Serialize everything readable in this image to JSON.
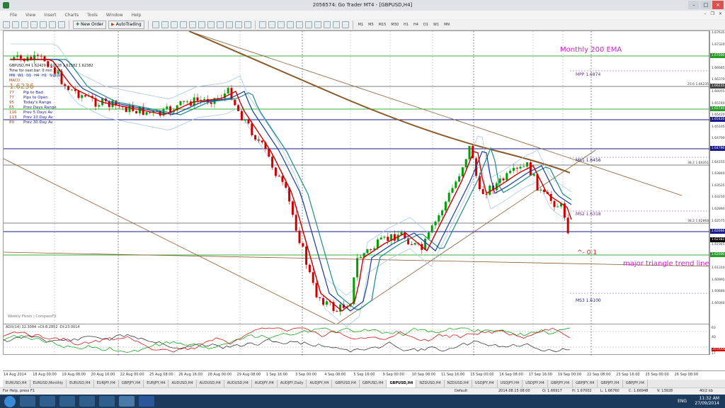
{
  "window": {
    "title": "2056574: Go Trader MT4 - [GBPUSD,H4]"
  },
  "menu": [
    "File",
    "View",
    "Insert",
    "Charts",
    "Tools",
    "Window",
    "Help"
  ],
  "toolbar": {
    "new_order": "New Order",
    "autotrading": "AutoTrading",
    "timeframes": [
      "M1",
      "M5",
      "M15",
      "M30",
      "H1",
      "H4",
      "D1",
      "W1",
      "MN"
    ]
  },
  "chart": {
    "header": "GBPUSD,H4  1.62429 1.62528 1.62382 1.62382",
    "time_line": "Time for next bar: 0 min 1 sec",
    "timeframe_row": [
      "MN",
      "W1",
      "D1",
      "H4",
      "H1",
      "Signals"
    ],
    "macd_label": "MACD",
    "price_big": "1.6236",
    "info_rows": [
      {
        "num": "77",
        "label": "Pip to Bad"
      },
      {
        "num": "77",
        "label": "Pips to Open"
      },
      {
        "num": "95",
        "label": "Today's Range"
      },
      {
        "num": "65",
        "label": "Prev Days Range"
      },
      {
        "num": "116",
        "label": "Prev 5 Days Av"
      },
      {
        "num": "113",
        "label": "Prev 10 Day Av"
      },
      {
        "num": "89",
        "label": "Prev 30 Day Av"
      }
    ],
    "ema_label": "Monthly 200 EMA",
    "trend_label": "major triangle trend line",
    "fib_zero": "^- 0:1",
    "pivots": {
      "mpp": "MPP  1.6874",
      "ms1": "MS1  1.6456",
      "ms2": "MS2  1.6318",
      "ms3": "MS3  1.6100"
    },
    "fibs": {
      "f236": "23.6  1.66235",
      "f382a": "38.2  1.64351",
      "f382b": "38.2  1.62868"
    },
    "watermark": "Weekly Pivots | CompassFX",
    "adx_label": "ADX(14) 32.3084 +DI:8.2852 -DI:23.0014"
  },
  "chart_colors": {
    "ema200": "#8b5a2b",
    "fast_ma": "#cc0000",
    "slow_ma": "#1a3a9c",
    "mid_ma": "#1a8a8a",
    "bands": "#a8c8e8",
    "bull": "#00a000",
    "bear": "#cc0000"
  },
  "price_scale": [
    "1.67635",
    "1.67320",
    "1.67000",
    "1.66685",
    "1.66370",
    "1.66055",
    "1.65740",
    "1.65420",
    "1.65105",
    "1.64790",
    "1.64475",
    "1.64155",
    "1.63840",
    "1.63525",
    "1.63210",
    "1.62890",
    "1.62575",
    "1.62260",
    "1.61945",
    "1.61625",
    "1.61310",
    "1.60995",
    "1.60680",
    "1.60360"
  ],
  "price_tags": [
    {
      "text": "1.67000",
      "color": "#2a9a2a"
    },
    {
      "text": "1.66235",
      "color": "#444444"
    },
    {
      "text": "1.65740",
      "color": "#2a9a2a"
    },
    {
      "text": "1.65420",
      "color": "#1a1a8c"
    },
    {
      "text": "1.64790",
      "color": "#1a1a8c"
    },
    {
      "text": "1.62666",
      "color": "#1a1a8c"
    },
    {
      "text": "1.62382",
      "color": "#000000"
    },
    {
      "text": "1.62000",
      "color": "#2a9a2a"
    }
  ],
  "adx_scale": [
    "63",
    "40",
    "20.0000",
    "17"
  ],
  "time_scale": [
    "14 Aug 2014",
    "18 Aug 00:00",
    "19 Aug 08:00",
    "20 Aug 16:00",
    "22 Aug 00:00",
    "25 Aug 08:00",
    "26 Aug 16:00",
    "28 Aug 00:00",
    "29 Aug 08:00",
    "1 Sep 16:00",
    "3 Sep 00:00",
    "4 Sep 08:00",
    "5 Sep 16:00",
    "9 Sep 00:00",
    "10 Sep 08:00",
    "11 Sep 16:00",
    "15 Sep 00:00",
    "16 Sep 08:00",
    "17 Sep 16:00",
    "19 Sep 00:00",
    "22 Sep 08:00",
    "23 Sep 16:00",
    "25 Sep 00:00",
    "26 Sep 08:00"
  ],
  "tabs": [
    "EURUSD,H4",
    "EURUSD,Monthly",
    "EURUSD,H4",
    "EURJPY,H4",
    "GBPJPY,H4",
    "EURJPY,H4",
    "AUDUSD,H4",
    "AUDUSD,H4",
    "AUDUSD,H4",
    "AUDJPY,H4",
    "AUDJPY,Daily",
    "AUDJPY,H4",
    "GBPUSD,H4",
    "GBPUSD,H4",
    "GBPUSD,H4",
    "NZDUSD,H4",
    "NZDUSD,H4",
    "USDJPY,H4",
    "USDJPY,H4",
    "USDJPY,H4",
    "GBPJPY,H4",
    "GBPJPY,H4",
    "GBPJPY,H4",
    "GBPJPY,H4"
  ],
  "active_tab": 14,
  "status": {
    "help": "For Help, press F1",
    "profile": "Default",
    "datetime": "2014.08.15 08:00",
    "open": "O: 1.66917",
    "high": "H: 1.67002",
    "low": "L: 1.66760",
    "close": "C: 1.66948",
    "vol": "V: 13928",
    "traffic": "40/2 kb"
  },
  "tray": {
    "lang": "ENG",
    "time": "11:32 AM",
    "date": "27/09/2014"
  }
}
